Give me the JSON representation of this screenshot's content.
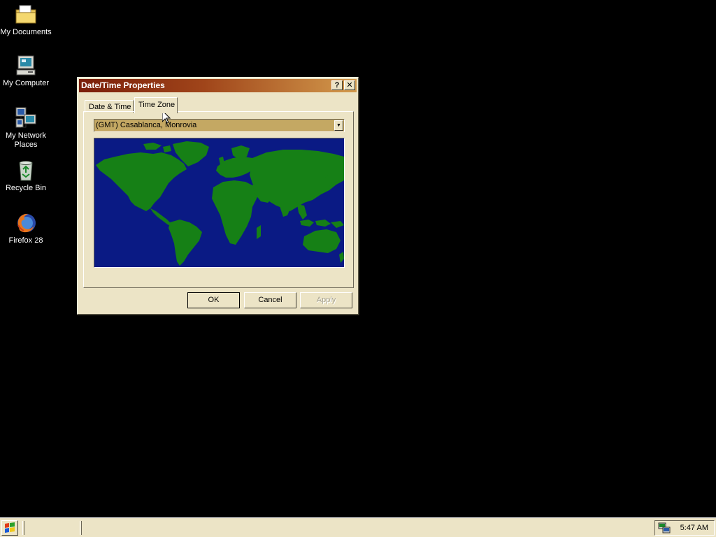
{
  "desktop": {
    "icons": [
      {
        "label": "My Documents",
        "icon": "folder-icon"
      },
      {
        "label": "My Computer",
        "icon": "computer-icon"
      },
      {
        "label_line1": "My Network",
        "label_line2": "Places",
        "icon": "network-places-icon"
      },
      {
        "label": "Recycle Bin",
        "icon": "recycle-bin-icon"
      },
      {
        "label": "Firefox 28",
        "icon": "firefox-icon"
      }
    ]
  },
  "dialog": {
    "title": "Date/Time Properties",
    "help_glyph": "?",
    "close_glyph": "✕",
    "tabs": [
      {
        "label": "Date & Time",
        "active": false
      },
      {
        "label": "Time Zone",
        "active": true
      }
    ],
    "timezone": {
      "selected": "(GMT) Casablanca, Monrovia",
      "arrow_glyph": "▼"
    },
    "map": {
      "ocean_color": "#0a1a84",
      "land_color": "#168016"
    },
    "buttons": {
      "ok": "OK",
      "cancel": "Cancel",
      "apply": "Apply"
    },
    "titlebar_colors": [
      "#7a1d09",
      "#d39a4c"
    ]
  },
  "taskbar": {
    "clock": "5:47 AM",
    "tray_icon": "network-tray-icon",
    "start_icon": "windows-logo-icon"
  }
}
